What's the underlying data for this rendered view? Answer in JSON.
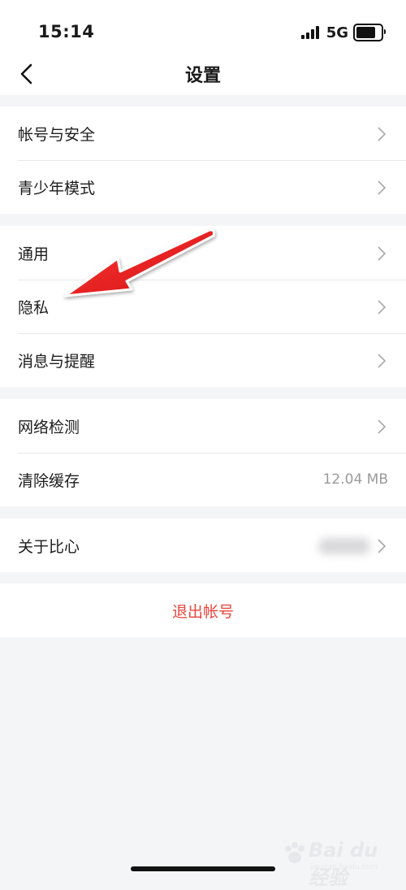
{
  "status_bar": {
    "time": "15:14",
    "network": "5G"
  },
  "nav": {
    "title": "设置"
  },
  "groups": [
    {
      "items": [
        {
          "label": "帐号与安全"
        },
        {
          "label": "青少年模式"
        }
      ]
    },
    {
      "items": [
        {
          "label": "通用"
        },
        {
          "label": "隐私"
        },
        {
          "label": "消息与提醒"
        }
      ]
    },
    {
      "items": [
        {
          "label": "网络检测"
        },
        {
          "label": "清除缓存",
          "value": "12.04 MB"
        }
      ]
    },
    {
      "items": [
        {
          "label": "关于比心"
        }
      ]
    }
  ],
  "logout": {
    "label": "退出帐号"
  },
  "watermark": {
    "text": "Bai du 经验",
    "sub": "jingyan.baidu.com"
  },
  "colors": {
    "accent_red": "#e8453c",
    "annotation_arrow": "#e31e1e",
    "background": "#f4f5f7"
  }
}
